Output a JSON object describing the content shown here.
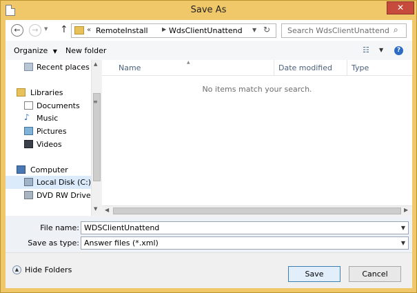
{
  "window": {
    "title": "Save As",
    "close_glyph": "✕"
  },
  "nav": {
    "back_glyph": "←",
    "forward_glyph": "→",
    "up_glyph": "↑",
    "address": {
      "overflow_glyph": "«",
      "segments": [
        "RemoteInstall",
        "WdsClientUnattend"
      ]
    },
    "search_placeholder": "Search WdsClientUnattend"
  },
  "toolbar": {
    "organize_label": "Organize",
    "new_folder_label": "New folder"
  },
  "nav_pane": {
    "items": [
      {
        "label": "Recent places",
        "icon": "recent-places-icon"
      },
      {
        "label": "Libraries",
        "icon": "libraries-icon"
      },
      {
        "label": "Documents",
        "icon": "documents-icon"
      },
      {
        "label": "Music",
        "icon": "music-icon"
      },
      {
        "label": "Pictures",
        "icon": "pictures-icon"
      },
      {
        "label": "Videos",
        "icon": "videos-icon"
      },
      {
        "label": "Computer",
        "icon": "computer-icon"
      },
      {
        "label": "Local Disk (C:)",
        "icon": "local-disk-icon",
        "selected": true
      },
      {
        "label": "DVD RW Drive (D",
        "icon": "dvd-drive-icon"
      }
    ]
  },
  "content": {
    "columns": [
      "Name",
      "Date modified",
      "Type"
    ],
    "sorted_column": "Name",
    "empty_message": "No items match your search."
  },
  "fields": {
    "file_name_label": "File name:",
    "file_name_value": "WDSClientUnattend",
    "save_type_label": "Save as type:",
    "save_type_value": "Answer files (*.xml)"
  },
  "footer": {
    "hide_folders_label": "Hide Folders",
    "save_label": "Save",
    "cancel_label": "Cancel"
  },
  "colors": {
    "frame": "#f0c86a",
    "close": "#c74b3c",
    "selection": "#dcebfc",
    "field_area": "#eef1f6"
  }
}
